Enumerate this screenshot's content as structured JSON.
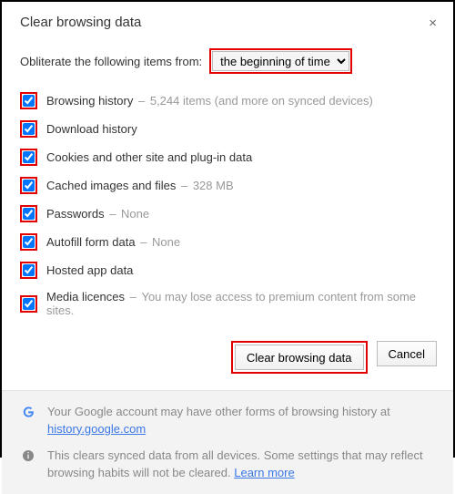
{
  "title": "Clear browsing data",
  "close_glyph": "×",
  "from_label": "Obliterate the following items from:",
  "time_range_selected": "the beginning of time",
  "items": [
    {
      "label": "Browsing history",
      "hint": "5,244 items (and more on synced devices)",
      "checked": true
    },
    {
      "label": "Download history",
      "hint": "",
      "checked": true
    },
    {
      "label": "Cookies and other site and plug-in data",
      "hint": "",
      "checked": true
    },
    {
      "label": "Cached images and files",
      "hint": "328 MB",
      "checked": true
    },
    {
      "label": "Passwords",
      "hint": "None",
      "checked": true
    },
    {
      "label": "Autofill form data",
      "hint": "None",
      "checked": true
    },
    {
      "label": "Hosted app data",
      "hint": "",
      "checked": true
    },
    {
      "label": "Media licences",
      "hint": "You may lose access to premium content from some sites.",
      "checked": true
    }
  ],
  "buttons": {
    "primary": "Clear browsing data",
    "cancel": "Cancel"
  },
  "footer": {
    "account_prefix": "Your Google account may have other forms of browsing history at ",
    "account_link": "history.google.com",
    "sync_prefix": "This clears synced data from all devices. Some settings that may reflect browsing habits will not be cleared. ",
    "learn_more": "Learn more"
  }
}
